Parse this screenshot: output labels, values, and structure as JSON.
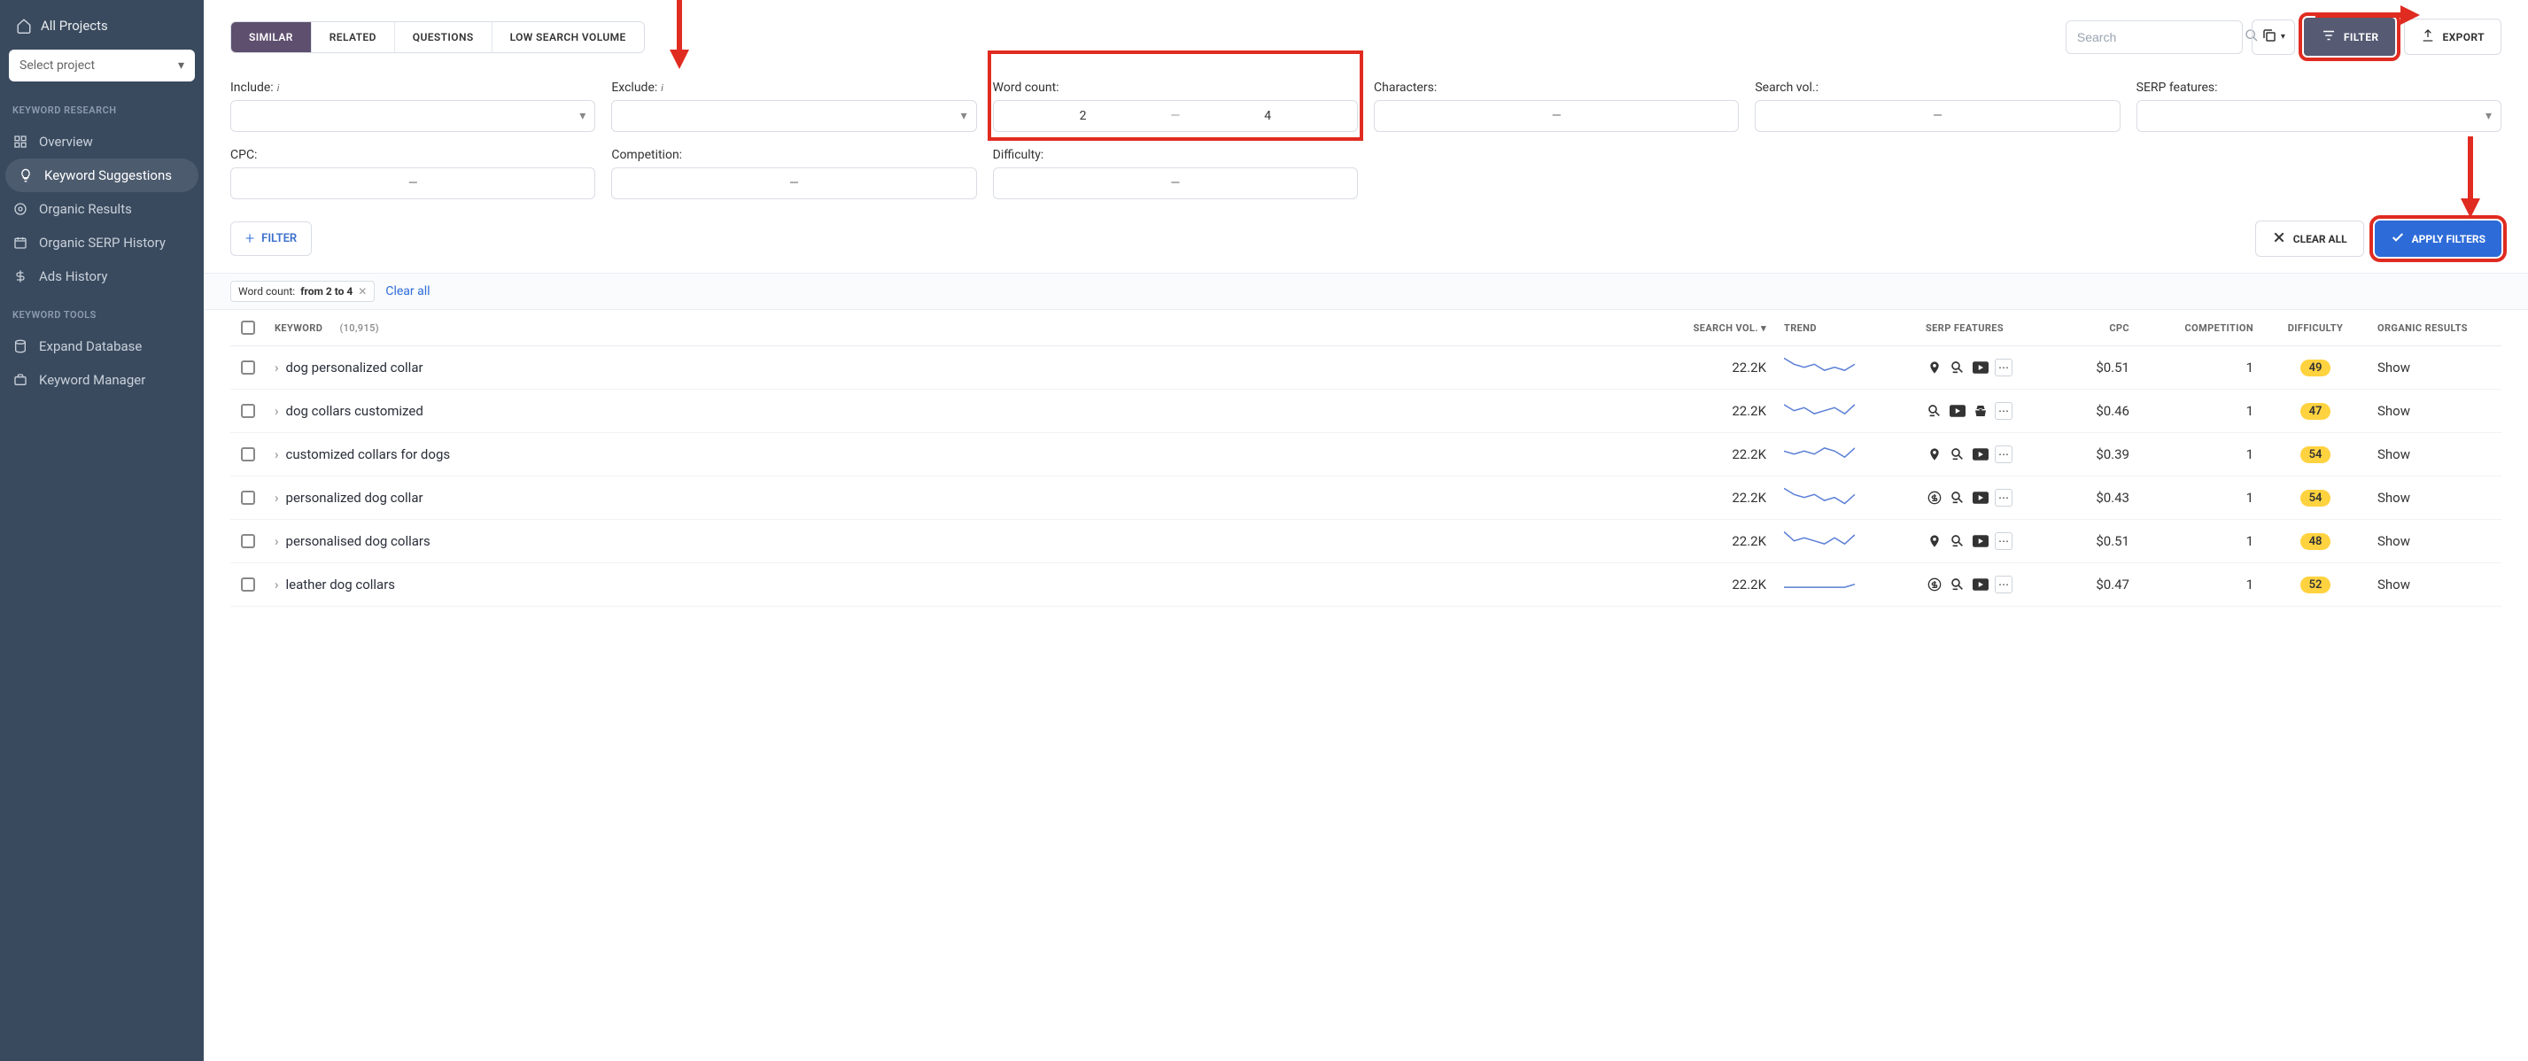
{
  "sidebar": {
    "all_projects": "All Projects",
    "select_project": "Select project",
    "sections": {
      "research": "KEYWORD RESEARCH",
      "tools": "KEYWORD TOOLS"
    },
    "research_items": [
      {
        "label": "Overview"
      },
      {
        "label": "Keyword Suggestions"
      },
      {
        "label": "Organic Results"
      },
      {
        "label": "Organic SERP History"
      },
      {
        "label": "Ads History"
      }
    ],
    "tools_items": [
      {
        "label": "Expand Database"
      },
      {
        "label": "Keyword Manager"
      }
    ]
  },
  "tabs": [
    "SIMILAR",
    "RELATED",
    "QUESTIONS",
    "LOW SEARCH VOLUME"
  ],
  "search": {
    "placeholder": "Search"
  },
  "buttons": {
    "filter": "FILTER",
    "export": "EXPORT",
    "clear_all": "CLEAR ALL",
    "apply": "APPLY FILTERS",
    "add_filter": "FILTER"
  },
  "filters": {
    "include": "Include:",
    "exclude": "Exclude:",
    "word_count": "Word count:",
    "characters": "Characters:",
    "search_vol": "Search vol.:",
    "serp_features": "SERP features:",
    "cpc": "CPC:",
    "competition": "Competition:",
    "difficulty": "Difficulty:",
    "word_count_min": "2",
    "word_count_max": "4"
  },
  "chips": {
    "word_count_label": "Word count:",
    "word_count_value": "from 2 to 4",
    "clear_all": "Clear all"
  },
  "table": {
    "headers": {
      "keyword": "KEYWORD",
      "count": "(10,915)",
      "search_vol": "SEARCH VOL.",
      "trend": "TREND",
      "serp": "SERP FEATURES",
      "cpc": "CPC",
      "competition": "COMPETITION",
      "difficulty": "DIFFICULTY",
      "organic": "ORGANIC RESULTS"
    },
    "rows": [
      {
        "keyword": "dog personalized collar",
        "vol": "22.2K",
        "cpc": "$0.51",
        "comp": "1",
        "diff": "49",
        "org": "Show",
        "serp": [
          "pin",
          "search",
          "video",
          "more"
        ]
      },
      {
        "keyword": "dog collars customized",
        "vol": "22.2K",
        "cpc": "$0.46",
        "comp": "1",
        "diff": "47",
        "org": "Show",
        "serp": [
          "search",
          "video",
          "basket",
          "more"
        ]
      },
      {
        "keyword": "customized collars for dogs",
        "vol": "22.2K",
        "cpc": "$0.39",
        "comp": "1",
        "diff": "54",
        "org": "Show",
        "serp": [
          "pin",
          "search",
          "video",
          "more"
        ]
      },
      {
        "keyword": "personalized dog collar",
        "vol": "22.2K",
        "cpc": "$0.43",
        "comp": "1",
        "diff": "54",
        "org": "Show",
        "serp": [
          "dollar",
          "search",
          "video",
          "more"
        ]
      },
      {
        "keyword": "personalised dog collars",
        "vol": "22.2K",
        "cpc": "$0.51",
        "comp": "1",
        "diff": "48",
        "org": "Show",
        "serp": [
          "pin",
          "search",
          "video",
          "more"
        ]
      },
      {
        "keyword": "leather dog collars",
        "vol": "22.2K",
        "cpc": "$0.47",
        "comp": "1",
        "diff": "52",
        "org": "Show",
        "serp": [
          "dollar",
          "search",
          "video",
          "more"
        ]
      }
    ]
  },
  "chart_data": {
    "type": "line",
    "note": "sparkline trend per row (relative, unlabeled)",
    "series": [
      {
        "name": "dog personalized collar",
        "values": [
          9,
          7,
          6,
          7,
          5,
          6,
          5,
          7
        ]
      },
      {
        "name": "dog collars customized",
        "values": [
          8,
          6,
          7,
          5,
          6,
          7,
          5,
          8
        ]
      },
      {
        "name": "customized collars for dogs",
        "values": [
          7,
          6,
          7,
          6,
          8,
          7,
          5,
          8
        ]
      },
      {
        "name": "personalized dog collar",
        "values": [
          9,
          7,
          6,
          7,
          5,
          6,
          4,
          7
        ]
      },
      {
        "name": "personalised dog collars",
        "values": [
          9,
          6,
          7,
          6,
          5,
          7,
          5,
          8
        ]
      },
      {
        "name": "leather dog collars",
        "values": [
          5,
          5,
          5,
          5,
          5,
          5,
          5,
          6
        ]
      }
    ]
  }
}
